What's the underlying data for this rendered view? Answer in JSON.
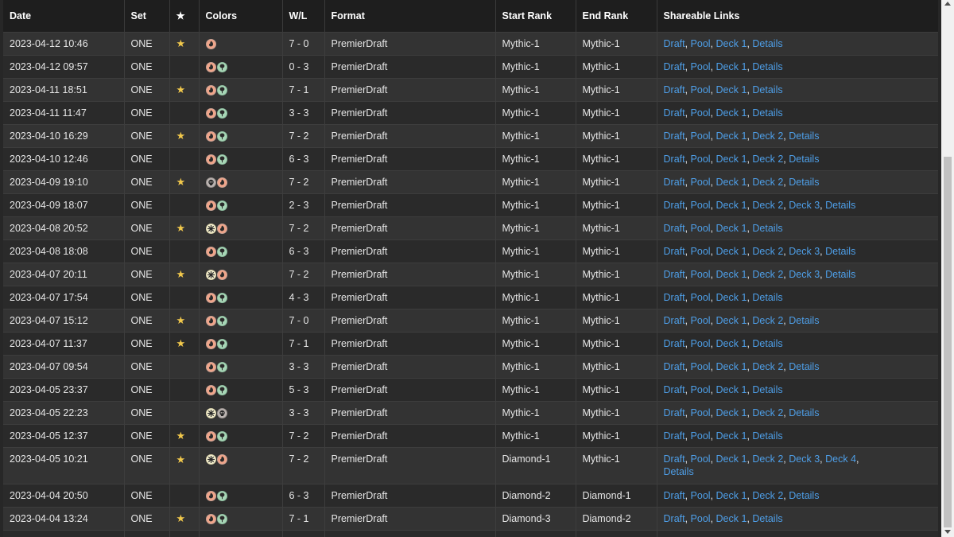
{
  "headers": {
    "date": "Date",
    "set": "Set",
    "star": "★",
    "colors": "Colors",
    "wl": "W/L",
    "format": "Format",
    "start_rank": "Start Rank",
    "end_rank": "End Rank",
    "links": "Shareable Links"
  },
  "colors": {
    "link": "#4e9fe8",
    "star": "#f2c94c",
    "background": "#272727"
  },
  "rows": [
    {
      "date": "2023-04-12 10:46",
      "set": "ONE",
      "star": true,
      "colors": [
        "R"
      ],
      "wl": "7 - 0",
      "format": "PremierDraft",
      "start": "Mythic-1",
      "end": "Mythic-1",
      "links": [
        "Draft",
        "Pool",
        "Deck 1",
        "Details"
      ]
    },
    {
      "date": "2023-04-12 09:57",
      "set": "ONE",
      "star": false,
      "colors": [
        "R",
        "G"
      ],
      "wl": "0 - 3",
      "format": "PremierDraft",
      "start": "Mythic-1",
      "end": "Mythic-1",
      "links": [
        "Draft",
        "Pool",
        "Deck 1",
        "Details"
      ]
    },
    {
      "date": "2023-04-11 18:51",
      "set": "ONE",
      "star": true,
      "colors": [
        "R",
        "G"
      ],
      "wl": "7 - 1",
      "format": "PremierDraft",
      "start": "Mythic-1",
      "end": "Mythic-1",
      "links": [
        "Draft",
        "Pool",
        "Deck 1",
        "Details"
      ]
    },
    {
      "date": "2023-04-11 11:47",
      "set": "ONE",
      "star": false,
      "colors": [
        "R",
        "G"
      ],
      "wl": "3 - 3",
      "format": "PremierDraft",
      "start": "Mythic-1",
      "end": "Mythic-1",
      "links": [
        "Draft",
        "Pool",
        "Deck 1",
        "Details"
      ]
    },
    {
      "date": "2023-04-10 16:29",
      "set": "ONE",
      "star": true,
      "colors": [
        "R",
        "G"
      ],
      "wl": "7 - 2",
      "format": "PremierDraft",
      "start": "Mythic-1",
      "end": "Mythic-1",
      "links": [
        "Draft",
        "Pool",
        "Deck 1",
        "Deck 2",
        "Details"
      ]
    },
    {
      "date": "2023-04-10 12:46",
      "set": "ONE",
      "star": false,
      "colors": [
        "R",
        "G"
      ],
      "wl": "6 - 3",
      "format": "PremierDraft",
      "start": "Mythic-1",
      "end": "Mythic-1",
      "links": [
        "Draft",
        "Pool",
        "Deck 1",
        "Deck 2",
        "Details"
      ]
    },
    {
      "date": "2023-04-09 19:10",
      "set": "ONE",
      "star": true,
      "colors": [
        "B",
        "R"
      ],
      "wl": "7 - 2",
      "format": "PremierDraft",
      "start": "Mythic-1",
      "end": "Mythic-1",
      "links": [
        "Draft",
        "Pool",
        "Deck 1",
        "Deck 2",
        "Details"
      ]
    },
    {
      "date": "2023-04-09 18:07",
      "set": "ONE",
      "star": false,
      "colors": [
        "R",
        "G"
      ],
      "wl": "2 - 3",
      "format": "PremierDraft",
      "start": "Mythic-1",
      "end": "Mythic-1",
      "links": [
        "Draft",
        "Pool",
        "Deck 1",
        "Deck 2",
        "Deck 3",
        "Details"
      ]
    },
    {
      "date": "2023-04-08 20:52",
      "set": "ONE",
      "star": true,
      "colors": [
        "W",
        "R"
      ],
      "wl": "7 - 2",
      "format": "PremierDraft",
      "start": "Mythic-1",
      "end": "Mythic-1",
      "links": [
        "Draft",
        "Pool",
        "Deck 1",
        "Details"
      ]
    },
    {
      "date": "2023-04-08 18:08",
      "set": "ONE",
      "star": false,
      "colors": [
        "R",
        "G"
      ],
      "wl": "6 - 3",
      "format": "PremierDraft",
      "start": "Mythic-1",
      "end": "Mythic-1",
      "links": [
        "Draft",
        "Pool",
        "Deck 1",
        "Deck 2",
        "Deck 3",
        "Details"
      ]
    },
    {
      "date": "2023-04-07 20:11",
      "set": "ONE",
      "star": true,
      "colors": [
        "W",
        "R"
      ],
      "wl": "7 - 2",
      "format": "PremierDraft",
      "start": "Mythic-1",
      "end": "Mythic-1",
      "links": [
        "Draft",
        "Pool",
        "Deck 1",
        "Deck 2",
        "Deck 3",
        "Details"
      ]
    },
    {
      "date": "2023-04-07 17:54",
      "set": "ONE",
      "star": false,
      "colors": [
        "R",
        "G"
      ],
      "wl": "4 - 3",
      "format": "PremierDraft",
      "start": "Mythic-1",
      "end": "Mythic-1",
      "links": [
        "Draft",
        "Pool",
        "Deck 1",
        "Details"
      ]
    },
    {
      "date": "2023-04-07 15:12",
      "set": "ONE",
      "star": true,
      "colors": [
        "R",
        "G"
      ],
      "wl": "7 - 0",
      "format": "PremierDraft",
      "start": "Mythic-1",
      "end": "Mythic-1",
      "links": [
        "Draft",
        "Pool",
        "Deck 1",
        "Deck 2",
        "Details"
      ]
    },
    {
      "date": "2023-04-07 11:37",
      "set": "ONE",
      "star": true,
      "colors": [
        "R",
        "G"
      ],
      "wl": "7 - 1",
      "format": "PremierDraft",
      "start": "Mythic-1",
      "end": "Mythic-1",
      "links": [
        "Draft",
        "Pool",
        "Deck 1",
        "Details"
      ]
    },
    {
      "date": "2023-04-07 09:54",
      "set": "ONE",
      "star": false,
      "colors": [
        "R",
        "G"
      ],
      "wl": "3 - 3",
      "format": "PremierDraft",
      "start": "Mythic-1",
      "end": "Mythic-1",
      "links": [
        "Draft",
        "Pool",
        "Deck 1",
        "Deck 2",
        "Details"
      ]
    },
    {
      "date": "2023-04-05 23:37",
      "set": "ONE",
      "star": false,
      "colors": [
        "R",
        "G"
      ],
      "wl": "5 - 3",
      "format": "PremierDraft",
      "start": "Mythic-1",
      "end": "Mythic-1",
      "links": [
        "Draft",
        "Pool",
        "Deck 1",
        "Details"
      ]
    },
    {
      "date": "2023-04-05 22:23",
      "set": "ONE",
      "star": false,
      "colors": [
        "W",
        "B"
      ],
      "wl": "3 - 3",
      "format": "PremierDraft",
      "start": "Mythic-1",
      "end": "Mythic-1",
      "links": [
        "Draft",
        "Pool",
        "Deck 1",
        "Deck 2",
        "Details"
      ]
    },
    {
      "date": "2023-04-05 12:37",
      "set": "ONE",
      "star": true,
      "colors": [
        "R",
        "G"
      ],
      "wl": "7 - 2",
      "format": "PremierDraft",
      "start": "Mythic-1",
      "end": "Mythic-1",
      "links": [
        "Draft",
        "Pool",
        "Deck 1",
        "Details"
      ]
    },
    {
      "date": "2023-04-05 10:21",
      "set": "ONE",
      "star": true,
      "colors": [
        "W",
        "R"
      ],
      "wl": "7 - 2",
      "format": "PremierDraft",
      "start": "Diamond-1",
      "end": "Mythic-1",
      "links": [
        "Draft",
        "Pool",
        "Deck 1",
        "Deck 2",
        "Deck 3",
        "Deck 4",
        "Details"
      ],
      "tall": true
    },
    {
      "date": "2023-04-04 20:50",
      "set": "ONE",
      "star": false,
      "colors": [
        "R",
        "G"
      ],
      "wl": "6 - 3",
      "format": "PremierDraft",
      "start": "Diamond-2",
      "end": "Diamond-1",
      "links": [
        "Draft",
        "Pool",
        "Deck 1",
        "Deck 2",
        "Details"
      ]
    },
    {
      "date": "2023-04-04 13:24",
      "set": "ONE",
      "star": true,
      "colors": [
        "R",
        "G"
      ],
      "wl": "7 - 1",
      "format": "PremierDraft",
      "start": "Diamond-3",
      "end": "Diamond-2",
      "links": [
        "Draft",
        "Pool",
        "Deck 1",
        "Details"
      ]
    },
    {
      "date": "",
      "set": "",
      "star": false,
      "colors": [],
      "wl": "",
      "format": "",
      "start": "",
      "end": "",
      "links": []
    }
  ]
}
